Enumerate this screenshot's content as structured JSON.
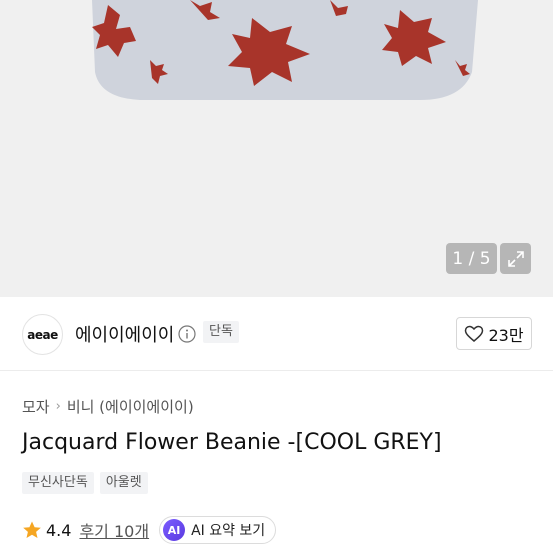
{
  "image_viewer": {
    "counter": "1 / 5",
    "colors": {
      "knit": "#cfd3dc",
      "flower": "#a8342a"
    }
  },
  "brand": {
    "logo_text": "aeae",
    "name": "에이이에이이",
    "exclusive_badge": "단독",
    "likes": "23만"
  },
  "breadcrumb": {
    "category": "모자",
    "subcategory": "비니 (에이이에이이)"
  },
  "product": {
    "title": "Jacquard Flower Beanie -[COOL GREY]",
    "tags": [
      "무신사단독",
      "아울렛"
    ]
  },
  "rating": {
    "score": "4.4",
    "reviews": "후기 10개",
    "ai_badge": "AI",
    "ai_summary": "AI 요약 보기",
    "star_color": "#f5a623"
  }
}
